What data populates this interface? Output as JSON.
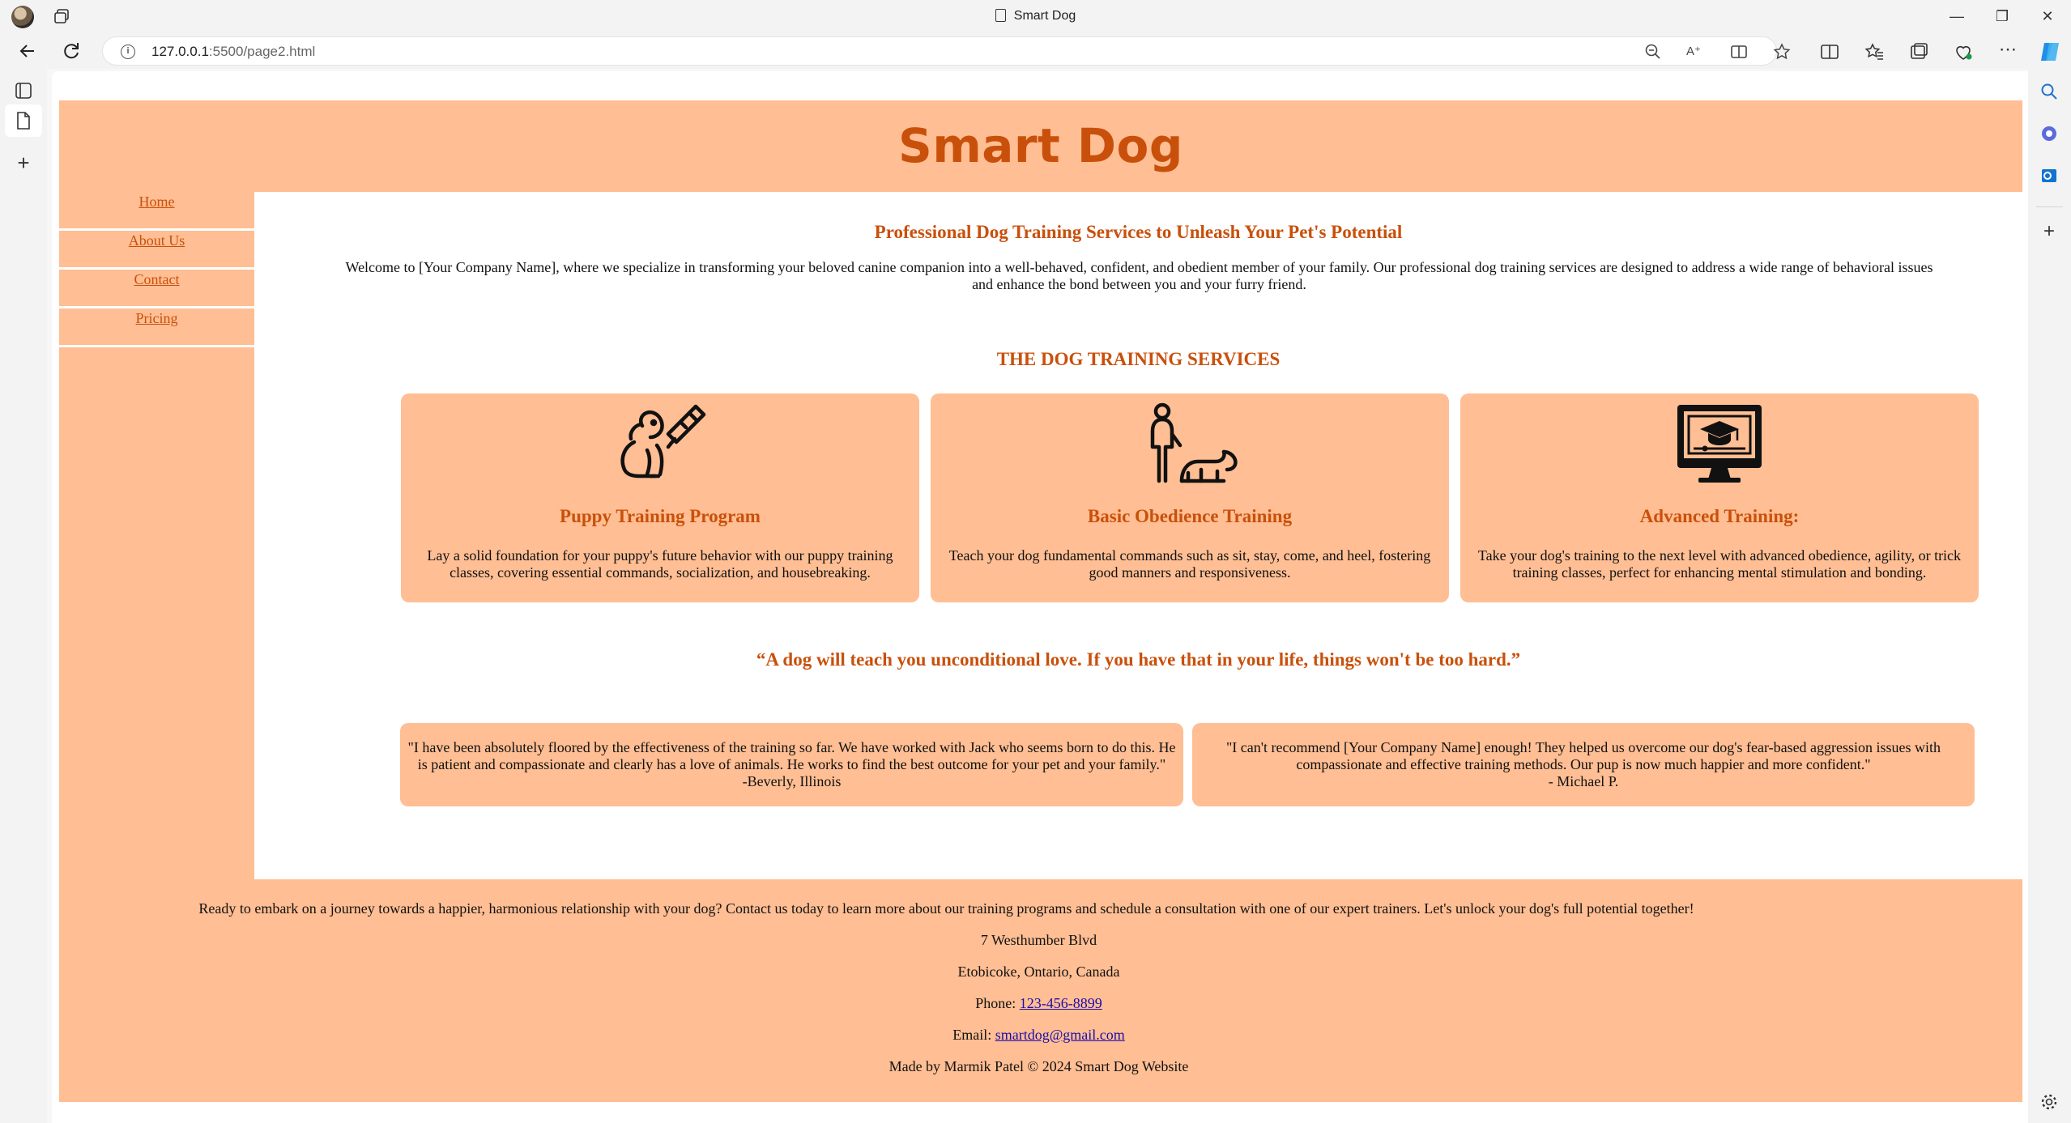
{
  "browser": {
    "tab_title": "Smart Dog",
    "url_host": "127.0.0.1",
    "url_rest": ":5500/page2.html"
  },
  "site": {
    "title": "Smart Dog",
    "nav": [
      "Home",
      "About Us",
      "Contact",
      "Pricing"
    ]
  },
  "intro": {
    "title": "Professional Dog Training Services to Unleash Your Pet's Potential",
    "text": "Welcome to [Your Company Name], where we specialize in transforming your beloved canine companion into a well-behaved, confident, and obedient member of your family. Our professional dog training services are designed to address a wide range of behavioral issues and enhance the bond between you and your furry friend."
  },
  "services": {
    "title": "THE DOG TRAINING SERVICES",
    "cards": [
      {
        "icon": "puppy-training-icon",
        "title": "Puppy Training Program",
        "text": "Lay a solid foundation for your puppy's future behavior with our puppy training classes, covering essential commands, socialization, and housebreaking."
      },
      {
        "icon": "obedience-training-icon",
        "title": "Basic Obedience Training",
        "text": "Teach your dog fundamental commands such as sit, stay, come, and heel, fostering good manners and responsiveness."
      },
      {
        "icon": "online-training-monitor-icon",
        "title": "Advanced Training:",
        "text": "Take your dog's training to the next level with advanced obedience, agility, or trick training classes, perfect for enhancing mental stimulation and bonding."
      }
    ]
  },
  "quote": "“A dog will teach you unconditional love. If you have that in your life, things won't be too hard.”",
  "testimonials": [
    {
      "text": "\"I have been absolutely floored by the effectiveness of the training so far. We have worked with Jack who seems born to do this. He is patient and compassionate and clearly has a love of animals. He works to find the best outcome for your pet and your family.\"",
      "author": "-Beverly, Illinois"
    },
    {
      "text": "\"I can't recommend [Your Company Name] enough! They helped us overcome our dog's fear-based aggression issues with compassionate and effective training methods. Our pup is now much happier and more confident.\"",
      "author": "- Michael P."
    }
  ],
  "footer": {
    "cta": "Ready to embark on a journey towards a happier, harmonious relationship with your dog? Contact us today to learn more about our training programs and schedule a consultation with one of our expert trainers. Let's unlock your dog's full potential together!",
    "address1": "7 Westhumber Blvd",
    "address2": "Etobicoke, Ontario, Canada",
    "phone_label": "Phone: ",
    "phone": "123-456-8899",
    "email_label": "Email: ",
    "email": "smartdog@gmail.com",
    "credit": "Made by Marmik Patel © 2024 Smart Dog Website"
  },
  "colors": {
    "accent": "#c9500b",
    "panel": "#ffbe93"
  }
}
